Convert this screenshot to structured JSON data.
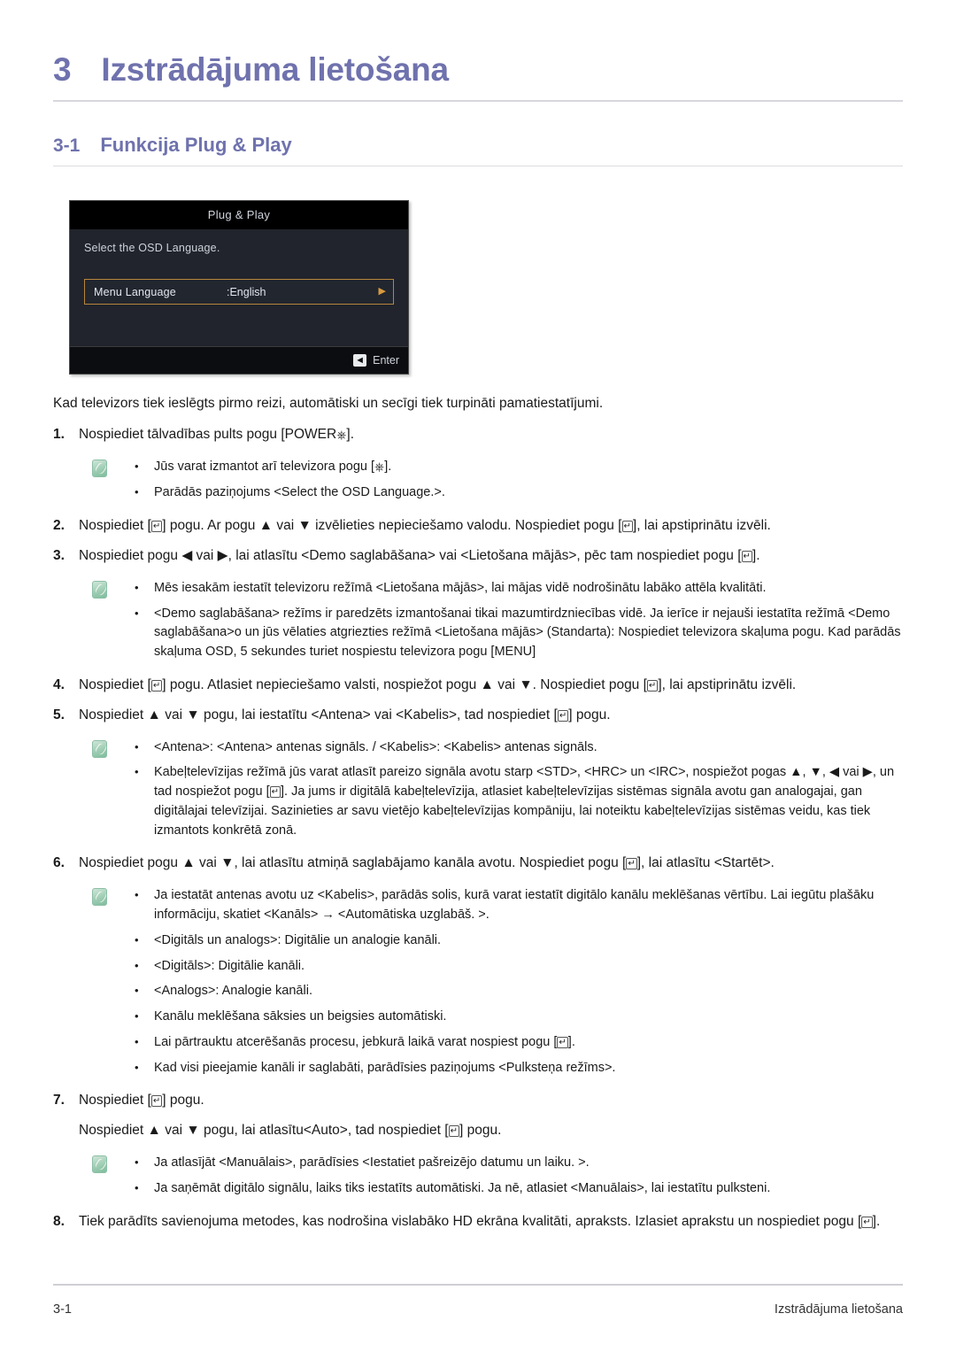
{
  "chapter": {
    "number": "3",
    "title": "Izstrādājuma lietošana"
  },
  "section": {
    "number": "3-1",
    "title": "Funkcija Plug & Play"
  },
  "osd": {
    "title": "Plug & Play",
    "prompt": "Select the OSD Language.",
    "row_label": "Menu Language",
    "row_value": ":English",
    "row_arrow": "▶",
    "enter_label": "Enter",
    "enter_icon": "enter-key-icon",
    "highlight_color": "#b8853c",
    "background_color": "#21242c",
    "title_background": "#000000"
  },
  "intro": "Kad televizors tiek ieslēgts pirmo reizi, automātiski un secīgi tiek turpināti pamatiestatījumi.",
  "steps": [
    {
      "number": "1.",
      "text_before": "Nospiediet tālvadības pults pogu [POWER ",
      "icon": "power-icon",
      "text_after": "]."
    }
  ],
  "step1": {
    "number": "1.",
    "pre": "Nospiediet tālvadības pults pogu [POWER",
    "post": "]."
  },
  "note1": {
    "icon": "note-icon",
    "bullets": [
      {
        "pre": "Jūs varat izmantot arī televizora pogu [",
        "post": "]."
      },
      {
        "pre": "Parādās paziņojums <Select the OSD Language.>.",
        "post": ""
      }
    ]
  },
  "step2": {
    "number": "2.",
    "p1": "Nospiediet [",
    "p2": "] pogu. Ar pogu ▲ vai ▼ izvēlieties nepieciešamo valodu. Nospiediet pogu [",
    "p3": "], lai apstiprinātu izvēli."
  },
  "step3": {
    "number": "3.",
    "p1": "Nospiediet pogu ◀ vai ▶, lai atlasītu <Demo saglabāšana> vai <Lietošana mājās>, pēc tam nospiediet pogu [",
    "p2": "]."
  },
  "note2": {
    "icon": "note-icon",
    "bullet1": "Mēs iesakām iestatīt televizoru režīmā <Lietošana mājās>, lai mājas vidē nodrošinātu labāko attēla kvalitāti.",
    "bullet2": "<Demo saglabāšana> režīms ir paredzēts izmantošanai tikai mazumtirdzniecības vidē. Ja ierīce ir nejauši iestatīta režīmā <Demo saglabāšana>o un jūs vēlaties atgriezties režīmā <Lietošana mājās> (Standarta): Nospiediet televizora skaļuma pogu. Kad parādās skaļuma OSD, 5 sekundes turiet nospiestu televizora pogu [MENU]"
  },
  "step4": {
    "number": "4.",
    "p1": "Nospiediet [",
    "p2": "] pogu. Atlasiet nepieciešamo valsti, nospiežot pogu ▲ vai ▼. Nospiediet pogu [",
    "p3": "], lai apstiprinātu izvēli."
  },
  "step5": {
    "number": "5.",
    "p1": "Nospiediet ▲ vai ▼ pogu, lai iestatītu <Antena> vai <Kabelis>, tad nospiediet [",
    "p2": "] pogu."
  },
  "note3": {
    "icon": "note-icon",
    "bullet1": "<Antena>: <Antena> antenas signāls. / <Kabelis>: <Kabelis> antenas signāls.",
    "bullet2_p1": "Kabeļtelevīzijas režīmā jūs varat atlasīt pareizo signāla avotu starp <STD>, <HRC> un <IRC>, nospiežot pogas ▲, ▼, ◀ vai ▶, un tad nospiežot pogu [",
    "bullet2_p2": "]. Ja jums ir digitālā kabeļtelevīzija, atlasiet kabeļtelevīzijas sistēmas signāla avotu gan analogajai, gan digitālajai televīzijai. Sazinieties ar savu vietējo kabeļtelevīzijas kompāniju, lai noteiktu kabeļtelevīzijas sistēmas veidu, kas tiek izmantots konkrētā zonā."
  },
  "step6": {
    "number": "6.",
    "p1": "Nospiediet pogu ▲ vai ▼, lai atlasītu atmiņā saglabājamo kanāla avotu. Nospiediet pogu [",
    "p2": "], lai atlasītu <Startēt>."
  },
  "note4": {
    "icon": "note-icon",
    "bullets": [
      "Ja iestatāt antenas avotu uz <Kabelis>, parādās solis, kurā varat iestatīt digitālo kanālu meklēšanas vērtību. Lai iegūtu plašāku informāciju, skatiet <Kanāls> → <Automātiska uzglabāš. >.",
      "<Digitāls un analogs>: Digitālie un analogie kanāli.",
      "<Digitāls>: Digitālie kanāli.",
      "<Analogs>: Analogie kanāli.",
      "Kanālu meklēšana sāksies un beigsies automātiski."
    ],
    "bullet_stop_p1": "Lai pārtrauktu atcerēšanās procesu, jebkurā laikā varat nospiest pogu [",
    "bullet_stop_p2": "].",
    "bullet_last": "Kad visi pieejamie kanāli ir saglabāti, parādīsies paziņojums <Pulksteņa režīms>."
  },
  "step7": {
    "number": "7.",
    "p1": "Nospiediet [",
    "p2": "] pogu.",
    "line2_p1": "Nospiediet ▲ vai ▼ pogu, lai atlasītu<Auto>, tad nospiediet [",
    "line2_p2": "] pogu."
  },
  "note5": {
    "icon": "note-icon",
    "bullet1": "Ja atlasījāt <Manuālais>, parādīsies <Iestatiet pašreizējo datumu un laiku. >.",
    "bullet2": "Ja saņēmāt digitālo signālu, laiks tiks iestatīts automātiski. Ja nē, atlasiet <Manuālais>, lai iestatītu pulksteni."
  },
  "step8": {
    "number": "8.",
    "p1": "Tiek parādīts savienojuma metodes, kas nodrošina vislabāko HD ekrāna kvalitāti, apraksts. Izlasiet aprakstu un nospiediet pogu [",
    "p2": "]."
  },
  "footer": {
    "left": "3-1",
    "right": "Izstrādājuma lietošana"
  },
  "colors": {
    "heading": "#6f72ad",
    "rule": "#d7d7de",
    "text": "#1a1a1a"
  }
}
